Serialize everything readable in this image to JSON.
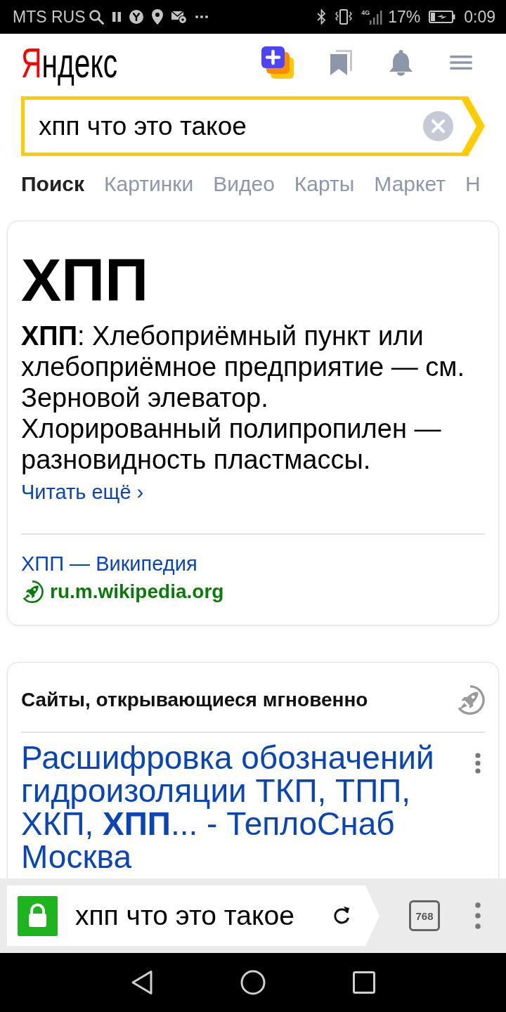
{
  "status_bar": {
    "carrier": "MTS RUS",
    "network_type": "4G",
    "battery": "17%",
    "time": "0:09"
  },
  "header": {
    "logo": "Яндекс"
  },
  "search": {
    "value": "хпп что это такое"
  },
  "tabs": [
    {
      "label": "Поиск",
      "selected": true
    },
    {
      "label": "Картинки",
      "selected": false
    },
    {
      "label": "Видео",
      "selected": false
    },
    {
      "label": "Карты",
      "selected": false
    },
    {
      "label": "Маркет",
      "selected": false
    },
    {
      "label": "Н",
      "selected": false
    }
  ],
  "fact_card": {
    "title": "ХПП",
    "paragraphs": [
      "**ХПП**: Хлебоприёмный пункт или хлебоприёмное предприятие — см. Зерновой элеватор.",
      "Хлорированный полипропилен — разновидность пластмассы."
    ],
    "read_more": "Читать ещё ›",
    "source_title": "ХПП — Википедия",
    "source_url": "ru.m.wikipedia.org"
  },
  "turbo_card": {
    "heading": "Сайты, открывающиеся мгновенно",
    "results": [
      {
        "title": "Расшифровка обозначений гидроизоляции ТКП, ТПП, ХКП, **ХПП**... - ТеплоСнаб Москва"
      }
    ]
  },
  "address_bar": {
    "secure": true,
    "text": "хпп что это такое"
  },
  "tab_count": "768"
}
